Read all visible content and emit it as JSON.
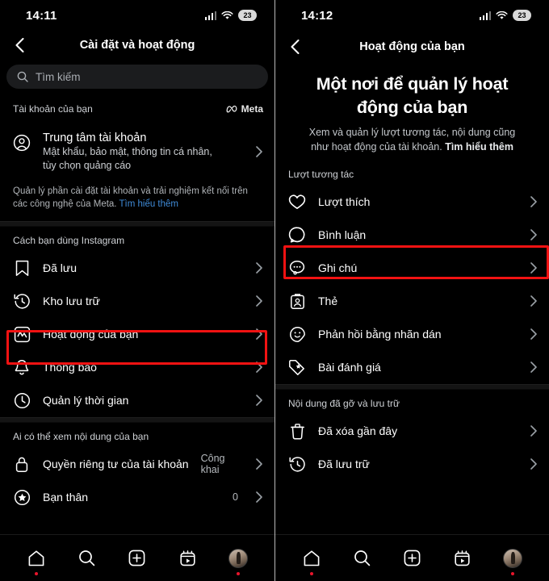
{
  "left": {
    "status": {
      "time": "14:11",
      "battery": "23",
      "signal_icon": "cellular-signal-icon",
      "wifi_icon": "wifi-icon"
    },
    "nav": {
      "back_icon": "back-chevron-icon",
      "title": "Cài đặt và hoạt động"
    },
    "search": {
      "icon": "search-icon",
      "placeholder": "Tìm kiếm",
      "value": ""
    },
    "account_section": {
      "header": "Tài khoản của bạn",
      "brand": "Meta",
      "brand_icon": "meta-infinity-icon",
      "item": {
        "icon": "account-circle-icon",
        "title": "Trung tâm tài khoản",
        "subtitle": "Mật khẩu, bảo mật, thông tin cá nhân, tùy chọn quảng cáo"
      },
      "note_text": "Quản lý phần cài đặt tài khoản và trải nghiệm kết nối trên các công nghệ của Meta. ",
      "note_link": "Tìm hiểu thêm"
    },
    "usage_section": {
      "header": "Cách bạn dùng Instagram",
      "items": [
        {
          "icon": "bookmark-icon",
          "label": "Đã lưu",
          "value": "",
          "highlighted": false
        },
        {
          "icon": "archive-clock-icon",
          "label": "Kho lưu trữ",
          "value": "",
          "highlighted": false
        },
        {
          "icon": "activity-chart-icon",
          "label": "Hoạt động của bạn",
          "value": "",
          "highlighted": true
        },
        {
          "icon": "bell-icon",
          "label": "Thông báo",
          "value": "",
          "highlighted": false
        },
        {
          "icon": "clock-icon",
          "label": "Quản lý thời gian",
          "value": "",
          "highlighted": false
        }
      ]
    },
    "visibility_section": {
      "header": "Ai có thể xem nội dung của bạn",
      "items": [
        {
          "icon": "lock-icon",
          "label": "Quyền riêng tư của tài khoản",
          "value": "Công khai"
        },
        {
          "icon": "star-circle-icon",
          "label": "Bạn thân",
          "value": "0"
        }
      ]
    },
    "tabbar": [
      {
        "icon": "home-icon",
        "dot": true
      },
      {
        "icon": "search-icon",
        "dot": false
      },
      {
        "icon": "add-square-icon",
        "dot": false
      },
      {
        "icon": "reels-icon",
        "dot": false
      },
      {
        "icon": "profile-avatar",
        "dot": true
      }
    ]
  },
  "right": {
    "status": {
      "time": "14:12",
      "battery": "23",
      "signal_icon": "cellular-signal-icon",
      "wifi_icon": "wifi-icon"
    },
    "nav": {
      "back_icon": "back-chevron-icon",
      "title": "Hoạt động của bạn"
    },
    "hero": {
      "title": "Một nơi để quản lý hoạt động của bạn",
      "desc_text": "Xem và quản lý lượt tương tác, nội dung cũng như hoạt động của tài khoản. ",
      "desc_link": "Tìm hiểu thêm"
    },
    "interactions_section": {
      "header": "Lượt tương tác",
      "items": [
        {
          "icon": "heart-icon",
          "label": "Lượt thích",
          "highlighted": false
        },
        {
          "icon": "comment-icon",
          "label": "Bình luận",
          "highlighted": true
        },
        {
          "icon": "note-bubble-icon",
          "label": "Ghi chú",
          "highlighted": false
        },
        {
          "icon": "tag-card-icon",
          "label": "Thẻ",
          "highlighted": false
        },
        {
          "icon": "sticker-icon",
          "label": "Phản hồi bằng nhãn dán",
          "highlighted": false
        },
        {
          "icon": "review-tag-icon",
          "label": "Bài đánh giá",
          "highlighted": false
        }
      ]
    },
    "removed_section": {
      "header": "Nội dung đã gỡ và lưu trữ",
      "items": [
        {
          "icon": "trash-icon",
          "label": "Đã xóa gần đây"
        },
        {
          "icon": "archive-clock-icon",
          "label": "Đã lưu trữ"
        }
      ]
    },
    "tabbar": [
      {
        "icon": "home-icon",
        "dot": true
      },
      {
        "icon": "search-icon",
        "dot": false
      },
      {
        "icon": "add-square-icon",
        "dot": false
      },
      {
        "icon": "reels-icon",
        "dot": false
      },
      {
        "icon": "profile-avatar",
        "dot": true
      }
    ]
  },
  "colors": {
    "highlight": "#f21212",
    "link": "#3f8bd8",
    "background": "#000000",
    "search_bg": "#1b1c1e",
    "notification_dot": "#e8152b"
  }
}
